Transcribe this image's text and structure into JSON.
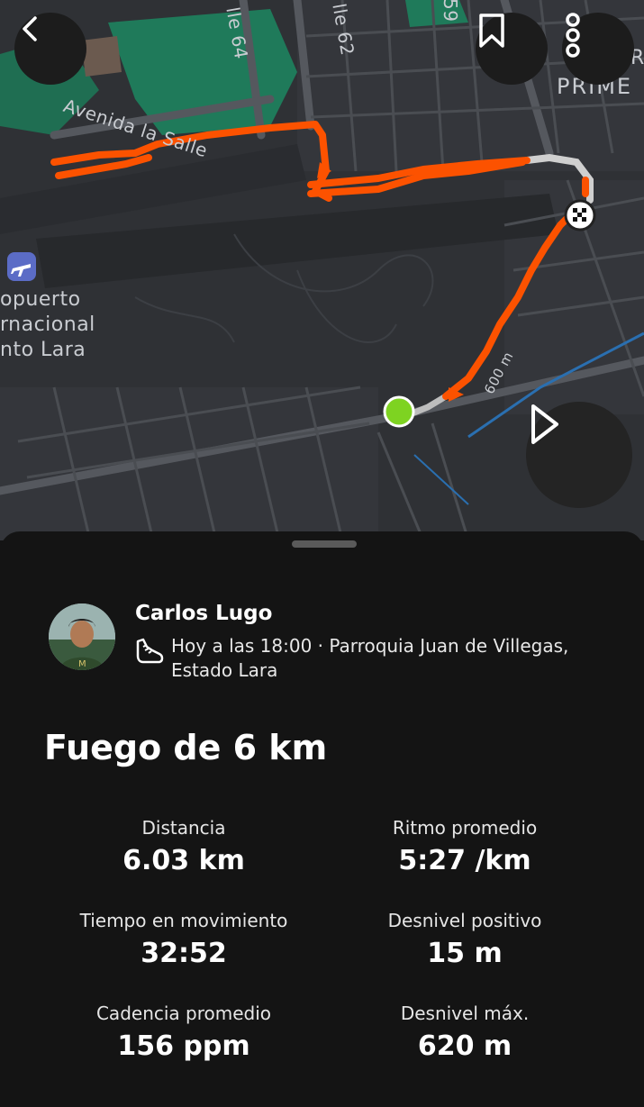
{
  "map": {
    "labels": {
      "street_64": "lle 64",
      "street_62": "lle 62",
      "street_59": "59",
      "avenue": "Avenida la Salle",
      "district": "PRIME",
      "district_r": "R",
      "airport_line1": "opuerto",
      "airport_line2": "rnacional",
      "airport_line3": "nto Lara",
      "scale": "600 m"
    },
    "route_color": "#fc5200",
    "start_color": "#7ed321"
  },
  "header": {
    "back_icon": "chevron-left-icon",
    "bookmark_icon": "bookmark-icon",
    "more_icon": "more-vertical-icon"
  },
  "play_icon": "play-icon",
  "activity": {
    "athlete": "Carlos Lugo",
    "meta": "Hoy a las 18:00 · Parroquia Juan de Villegas, Estado Lara",
    "title": "Fuego de 6 km"
  },
  "stats": [
    {
      "label": "Distancia",
      "value": "6.03 km"
    },
    {
      "label": "Ritmo promedio",
      "value": "5:27 /km"
    },
    {
      "label": "Tiempo en movimiento",
      "value": "32:52"
    },
    {
      "label": "Desnivel positivo",
      "value": "15 m"
    },
    {
      "label": "Cadencia promedio",
      "value": "156 ppm"
    },
    {
      "label": "Desnivel máx.",
      "value": "620 m"
    }
  ]
}
